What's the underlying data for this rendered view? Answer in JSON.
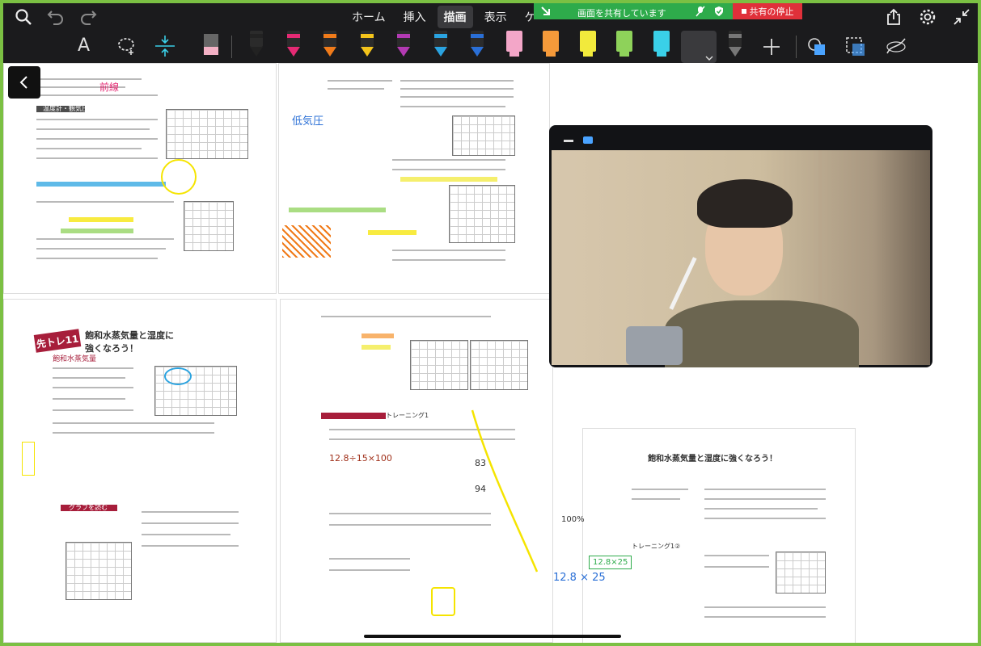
{
  "topbar": {
    "tabs": [
      "ホーム",
      "挿入",
      "描画",
      "表示",
      "ケ"
    ],
    "active_tab": "描画",
    "share_status": "画面を共有しています",
    "stop_share_label": "共有の停止"
  },
  "toolbar": {
    "text_tool_label": "A",
    "pens": [
      {
        "type": "pen",
        "color": "#222222"
      },
      {
        "type": "pen",
        "color": "#e52a74"
      },
      {
        "type": "pen",
        "color": "#f07b1a"
      },
      {
        "type": "pen",
        "color": "#f4c41b"
      },
      {
        "type": "pen",
        "color": "#b33ab3"
      },
      {
        "type": "pen",
        "color": "#2aa3e0"
      },
      {
        "type": "pen",
        "color": "#2a6fd6"
      },
      {
        "type": "marker",
        "color": "#f3a6c8"
      },
      {
        "type": "marker",
        "color": "#f59a3a"
      },
      {
        "type": "marker",
        "color": "#f2ea3c"
      },
      {
        "type": "marker",
        "color": "#8ed25a"
      },
      {
        "type": "marker",
        "color": "#3ad0e8"
      },
      {
        "type": "pen",
        "color": "#ffffff"
      },
      {
        "type": "pen",
        "color": "#777777"
      }
    ]
  },
  "document": {
    "page_texts": {
      "top_left_title": "前線",
      "top_left_section": "温度計・観気圧",
      "mid_left_banner": "先トレ11",
      "mid_left_title": "飽和水蒸気量と湿度に強くなろう！",
      "mid_left_subtitle": "飽和水蒸気量",
      "mid_left_section": "グラフを読む",
      "mid_right_section": "トレーニング1",
      "right_page_title": "飽和水蒸気量と湿度に強くなろう！",
      "right_page_sub": "トレーニング1②"
    },
    "handwritten": {
      "pink_note": "低気圧",
      "orange_calc": "12.8÷15×100",
      "yellow_box_a": "83",
      "yellow_box_b": "94",
      "result": "12.8 × 25",
      "green_box": "12.8×25",
      "percent_label": "100%"
    }
  },
  "colors": {
    "frame_border": "#7bc043",
    "share_green": "#2eab4b",
    "stop_red": "#e0303a",
    "toolbar_bg": "#1b1b1d"
  }
}
